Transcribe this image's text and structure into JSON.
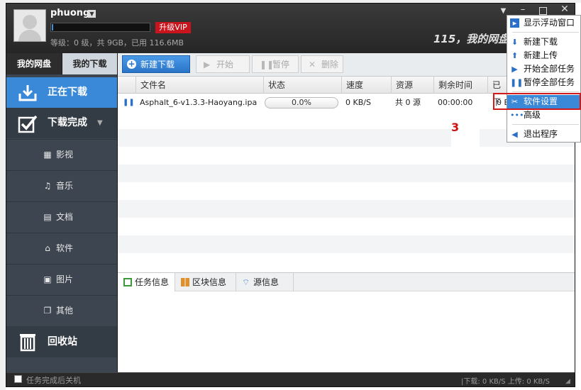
{
  "header": {
    "username": "phuong",
    "vip_label": "升级VIP",
    "quota_text": "等级：0 级，共 9GB，已用 116.6MB",
    "brand": "115，我的网盘"
  },
  "window_controls": {
    "menu_arrow": "▼",
    "minimize": "–",
    "close": "✕"
  },
  "sidebar": {
    "tabs": [
      {
        "label": "我的网盘",
        "selected": false
      },
      {
        "label": "我的下载",
        "selected": true
      }
    ],
    "downloading": "正在下载",
    "completed": "下载完成",
    "categories": [
      {
        "label": "影视",
        "icon": "film-icon"
      },
      {
        "label": "音乐",
        "icon": "music-note-icon"
      },
      {
        "label": "文档",
        "icon": "document-icon"
      },
      {
        "label": "软件",
        "icon": "software-icon"
      },
      {
        "label": "图片",
        "icon": "picture-icon"
      },
      {
        "label": "其他",
        "icon": "other-files-icon"
      }
    ],
    "recycle": "回收站"
  },
  "toolbar": {
    "new_download": "新建下载",
    "start": "开始",
    "pause": "暂停",
    "delete": "删除"
  },
  "table": {
    "columns": [
      "文件名",
      "状态",
      "速度",
      "资源",
      "剩余时间",
      "已下"
    ],
    "rows": [
      {
        "filename": "Asphalt_6-v1.3.3-Haoyang.ipa",
        "progress_text": "0.0%",
        "progress": 0.0,
        "speed": "0 KB/S",
        "sources": "共 0 源",
        "remaining": "00:00:00",
        "downloaded": "0 By"
      }
    ]
  },
  "bottom_tabs": [
    {
      "label": "任务信息"
    },
    {
      "label": "区块信息"
    },
    {
      "label": "源信息"
    }
  ],
  "statusbar": {
    "shutdown_label": "任务完成后关机",
    "speed_text": "|下载: 0 KB/S  上传: 0 KB/S"
  },
  "context_menu": {
    "items": [
      {
        "label": "显示浮动窗口"
      },
      {
        "label": "新建下载"
      },
      {
        "label": "新建上传"
      },
      {
        "label": "开始全部任务"
      },
      {
        "label": "暂停全部任务"
      },
      {
        "label": "软件设置",
        "highlighted": true
      },
      {
        "label": "高级"
      },
      {
        "label": "退出程序"
      }
    ]
  },
  "annotation": {
    "number": "3"
  },
  "colors": {
    "accent": "#3a88d8",
    "vip": "#c8141c",
    "annotation": "#d21a1a"
  }
}
